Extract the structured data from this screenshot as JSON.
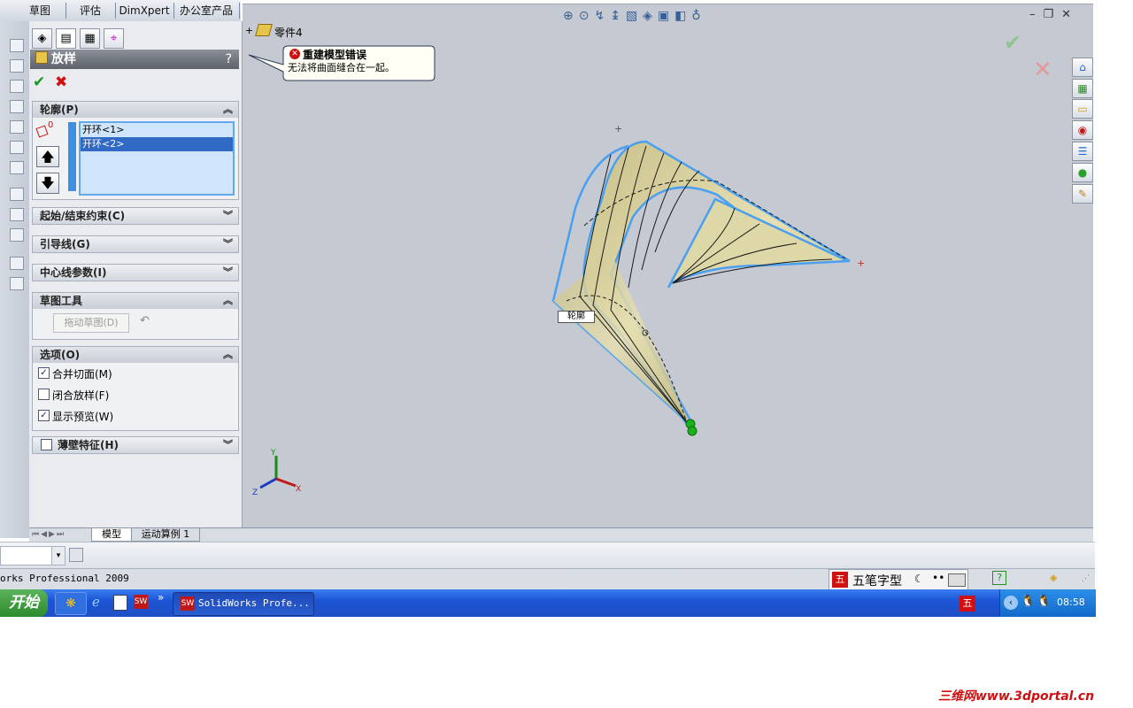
{
  "top_tabs": [
    "草图",
    "评估",
    "DimXpert",
    "办公室产品"
  ],
  "feature": {
    "title": "放样",
    "help": "?",
    "ok": "✔",
    "cancel": "✖"
  },
  "sections": {
    "profile": {
      "label": "轮廓(P)",
      "items": [
        "开环<1>",
        "开环<2>"
      ],
      "selected_index": 1,
      "counter": "0"
    },
    "start_end": {
      "label": "起始/结束约束(C)"
    },
    "guide": {
      "label": "引导线(G)"
    },
    "centerline": {
      "label": "中心线参数(I)"
    },
    "sketch_tools": {
      "label": "草图工具",
      "drag_button": "拖动草图(D)"
    },
    "options": {
      "label": "选项(O)",
      "items": [
        {
          "label": "合并切面(M)",
          "checked": true
        },
        {
          "label": "闭合放样(F)",
          "checked": false
        },
        {
          "label": "显示预览(W)",
          "checked": true
        }
      ]
    },
    "thin": {
      "label": "薄壁特征(H)"
    }
  },
  "tree": {
    "expander": "+",
    "part_name": "零件4"
  },
  "error_tooltip": {
    "title": "重建模型错误",
    "message": "无法将曲面缝合在一起。"
  },
  "viewport_label": "轮廓",
  "axis_labels": {
    "x": "X",
    "y": "Y",
    "z": "Z"
  },
  "bottom_tabs": [
    "模型",
    "运动算例 1"
  ],
  "status_text": "orks Professional 2009",
  "ime": {
    "label": "五笔字型"
  },
  "taskbar": {
    "start": "开始",
    "app_button": "SolidWorks Profe...",
    "clock": "08:58",
    "chevrons": "»"
  },
  "watermark": "三维网www.3dportal.cn",
  "colors": {
    "accent_blue": "#2f6fd6",
    "error_red": "#d01010",
    "ok_green": "#1a9a1a",
    "surface": "#d9d2a3"
  }
}
